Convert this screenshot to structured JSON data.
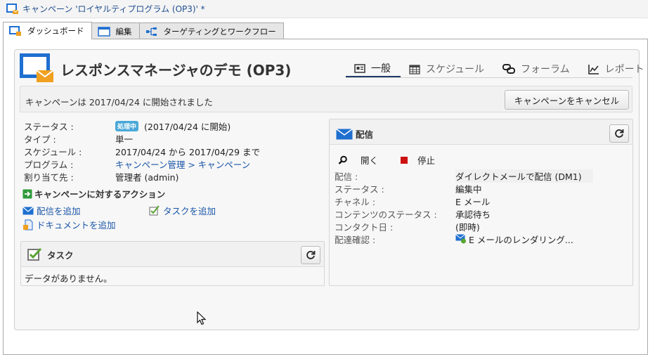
{
  "window": {
    "title": "キャンペーン 'ロイヤルティプログラム (OP3)' *",
    "tabs": [
      {
        "label": "ダッシュボード",
        "icon": "dashboard-icon",
        "active": true
      },
      {
        "label": "編集",
        "icon": "edit-window-icon",
        "active": false
      },
      {
        "label": "ターゲティングとワークフロー",
        "icon": "workflow-icon",
        "active": false
      }
    ]
  },
  "header": {
    "title": "レスポンスマネージャのデモ (OP3)",
    "nav": [
      {
        "label": "一般",
        "icon": "general-icon",
        "active": true
      },
      {
        "label": "スケジュール",
        "icon": "calendar-icon",
        "active": false
      },
      {
        "label": "フォーラム",
        "icon": "forum-icon",
        "active": false
      },
      {
        "label": "レポート",
        "icon": "report-icon",
        "active": false
      }
    ]
  },
  "status_bar": {
    "message": "キャンペーンは 2017/04/24 に開始されました",
    "cancel_label": "キャンペーンをキャンセル"
  },
  "properties": {
    "status_label": "ステータス :",
    "status_badge": "処理中",
    "status_value": "(2017/04/24 に開始)",
    "type_label": "タイプ :",
    "type_value": "単一",
    "schedule_label": "スケジュール :",
    "schedule_value": "2017/04/24 から 2017/04/29 まで",
    "program_label": "プログラム :",
    "program_value": "キャンペーン管理 > キャンペーン",
    "assignee_label": "割り当て先 :",
    "assignee_value": "管理者 (admin)"
  },
  "actions": {
    "title": "キャンペーンに対するアクション",
    "add_delivery": "配信を追加",
    "add_task": "タスクを追加",
    "add_document": "ドキュメントを追加"
  },
  "task_box": {
    "title": "タスク",
    "empty": "データがありません。"
  },
  "delivery_box": {
    "title": "配信",
    "open_label": "開く",
    "stop_label": "停止",
    "rows": [
      {
        "label": "配信 :",
        "value": "ダイレクトメールで配信 (DM1)"
      },
      {
        "label": "ステータス :",
        "value": "編集中"
      },
      {
        "label": "チャネル :",
        "value": "E メール"
      },
      {
        "label": "コンテンツのステータス :",
        "value": "承認待ち"
      },
      {
        "label": "コンタクト日 :",
        "value": "(即時)"
      },
      {
        "label": "配達確認 :",
        "value": "E メールのレンダリング..."
      }
    ]
  },
  "colors": {
    "link": "#1a56a8",
    "badge": "#4aa8d8",
    "brand_blue": "#1e6fd0",
    "envelope_orange": "#f0a020",
    "stop_red": "#cc1111"
  }
}
